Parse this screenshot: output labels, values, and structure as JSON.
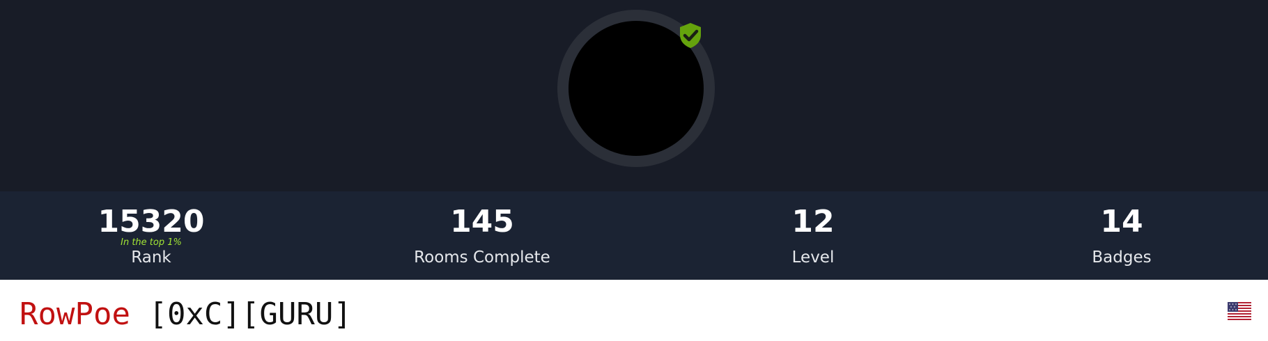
{
  "banner": {
    "avatar_icon": "avatar",
    "verified_icon": "verified-shield-check-icon",
    "verified_color": "#65a30d"
  },
  "stats": [
    {
      "value": "15320",
      "label": "Rank",
      "sub": "In the top 1%"
    },
    {
      "value": "145",
      "label": "Rooms Complete"
    },
    {
      "value": "12",
      "label": "Level"
    },
    {
      "value": "14",
      "label": "Badges"
    }
  ],
  "profile": {
    "username": "RowPoe",
    "tags": "[0xC][GURU]",
    "username_color": "#c11111",
    "flag_icon": "us-flag-icon"
  }
}
